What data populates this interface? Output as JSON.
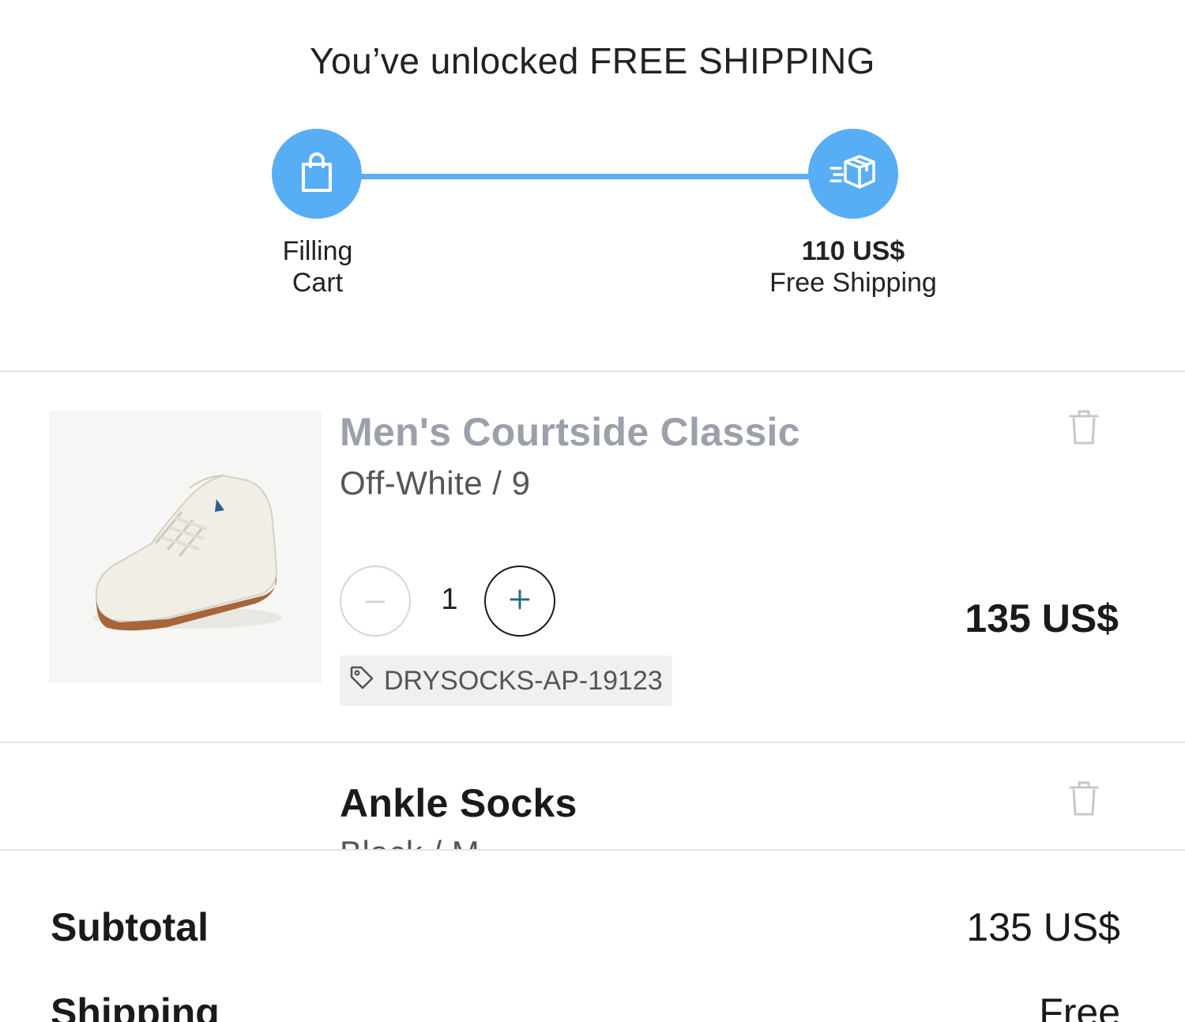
{
  "banner": {
    "title": "You’ve unlocked FREE SHIPPING",
    "accent_color": "#58aef4",
    "steps": [
      {
        "icon": "shopping-bag-icon",
        "line1": "Filling",
        "line2": "Cart"
      },
      {
        "icon": "shipping-box-icon",
        "line1": "110 US$",
        "line2": "Free Shipping"
      }
    ],
    "progress": 1.0
  },
  "cart": {
    "items": [
      {
        "name": "Men's Courtside Classic",
        "variant": "Off-White / 9",
        "quantity": "1",
        "minus_label": "−",
        "plus_label": "+",
        "price": "135 US$",
        "discount_code": "DRYSOCKS-AP-19123",
        "image": "white-sneaker-image"
      },
      {
        "name": "Ankle Socks",
        "variant": "Black / M"
      }
    ]
  },
  "summary": {
    "subtotal_label": "Subtotal",
    "subtotal_value": "135 US$",
    "shipping_label": "Shipping",
    "shipping_value": "Free"
  }
}
